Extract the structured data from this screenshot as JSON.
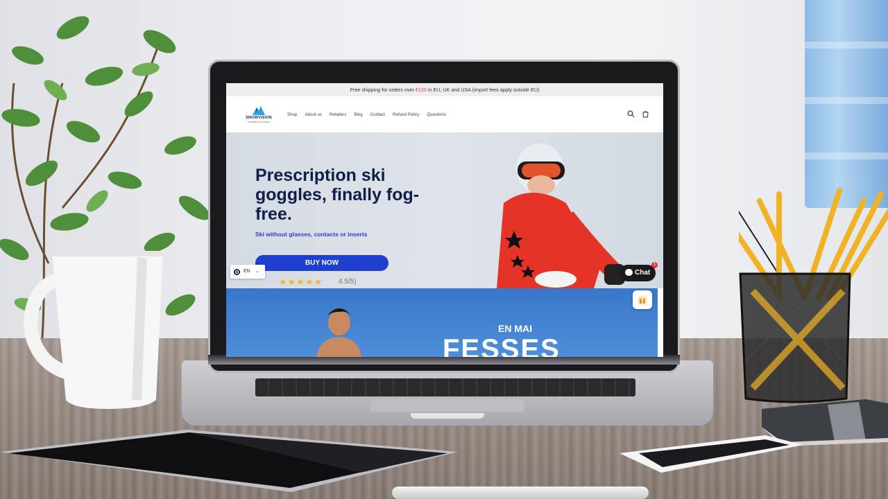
{
  "announcement": {
    "prefix": "Free shipping for orders over ",
    "amount": "€120",
    "suffix": " in EU, UK and USA (import fees apply outside EU)"
  },
  "brand": {
    "name": "SNOWVISION",
    "tagline": "A BRAND OF A VISION"
  },
  "nav": [
    "Shop",
    "About us",
    "Retailers",
    "Blog",
    "Contact",
    "Refund Policy",
    "Questions"
  ],
  "header_icons": [
    "search-icon",
    "cart-icon"
  ],
  "hero": {
    "title": "Prescription ski goggles, finally fog-free.",
    "subtitle": "Ski without glasses, contacts or inserts",
    "cta": "BUY NOW",
    "stars": "★★★★★",
    "rating_text": "4.5/5)",
    "rating_value": 4.5
  },
  "language": {
    "code": "EN"
  },
  "chat": {
    "label": "Chat",
    "badge": "1"
  },
  "promo": {
    "kicker": "EN MAI",
    "headline": "FESSES"
  },
  "colors": {
    "primary": "#1e3fcf",
    "heading": "#0f1f4a",
    "highlight": "#e23a2e",
    "promo": "#3977c9"
  }
}
